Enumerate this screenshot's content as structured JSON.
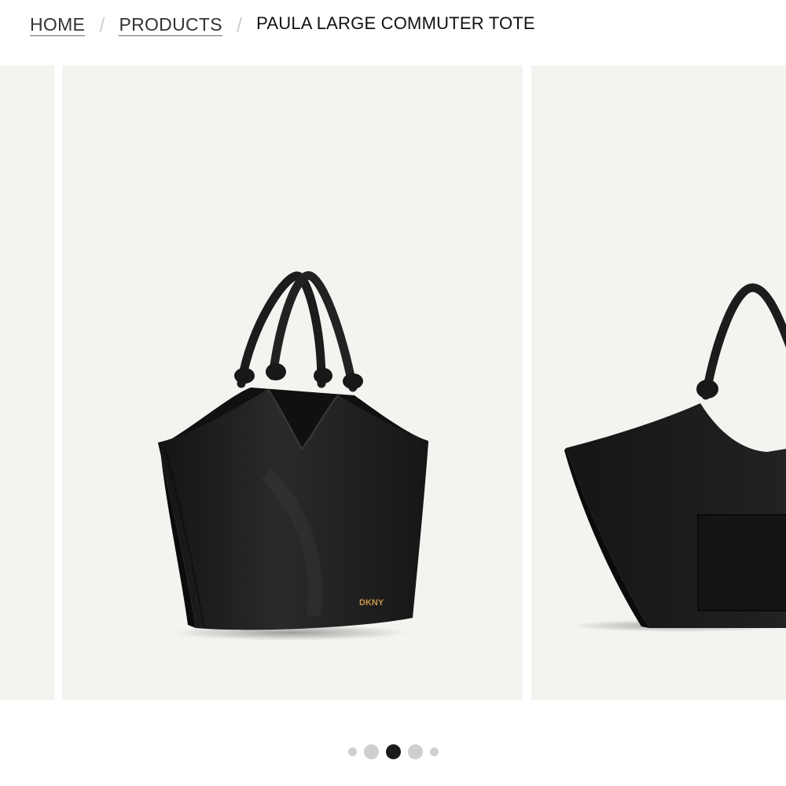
{
  "breadcrumb": {
    "home": "HOME",
    "products": "PRODUCTS",
    "separator": "/",
    "current": "PAULA LARGE COMMUTER TOTE"
  },
  "product": {
    "logo_text": "DKNY",
    "image_alt_main": "Paula large commuter tote, black leather, angled view",
    "image_alt_next": "Paula large commuter tote, black leather, back view with pocket"
  },
  "carousel": {
    "active_index": 2,
    "slide_count": 5
  },
  "colors": {
    "background": "#ffffff",
    "slide_bg": "#f4f3f0",
    "bag": "#1b1b1b",
    "logo": "#c9954c",
    "dot_active": "#1a1a1a",
    "dot_inactive": "#cfcfcf"
  }
}
